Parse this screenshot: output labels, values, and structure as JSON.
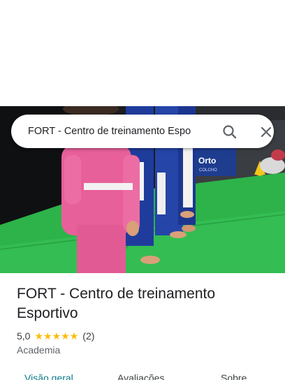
{
  "search": {
    "query": "FORT - Centro de treinamento Espo",
    "search_icon": "search-icon",
    "close_icon": "close-icon"
  },
  "place": {
    "name": "FORT - Centro de treinamento Esportivo",
    "rating": "5,0",
    "stars": 5,
    "review_count": "(2)",
    "category": "Academia"
  },
  "photo": {
    "sign_text": "Orto",
    "sign_subtext": "COLCHO"
  },
  "tabs": [
    {
      "label": "Visão geral",
      "active": true
    },
    {
      "label": "Avaliações",
      "active": false
    },
    {
      "label": "Sobre",
      "active": false
    }
  ],
  "colors": {
    "star": "#fbbc04",
    "active_tab": "#0b7a8a",
    "mat_green": "#2db34a",
    "gi_pink": "#e8609a",
    "gi_blue": "#1f3c9c"
  }
}
